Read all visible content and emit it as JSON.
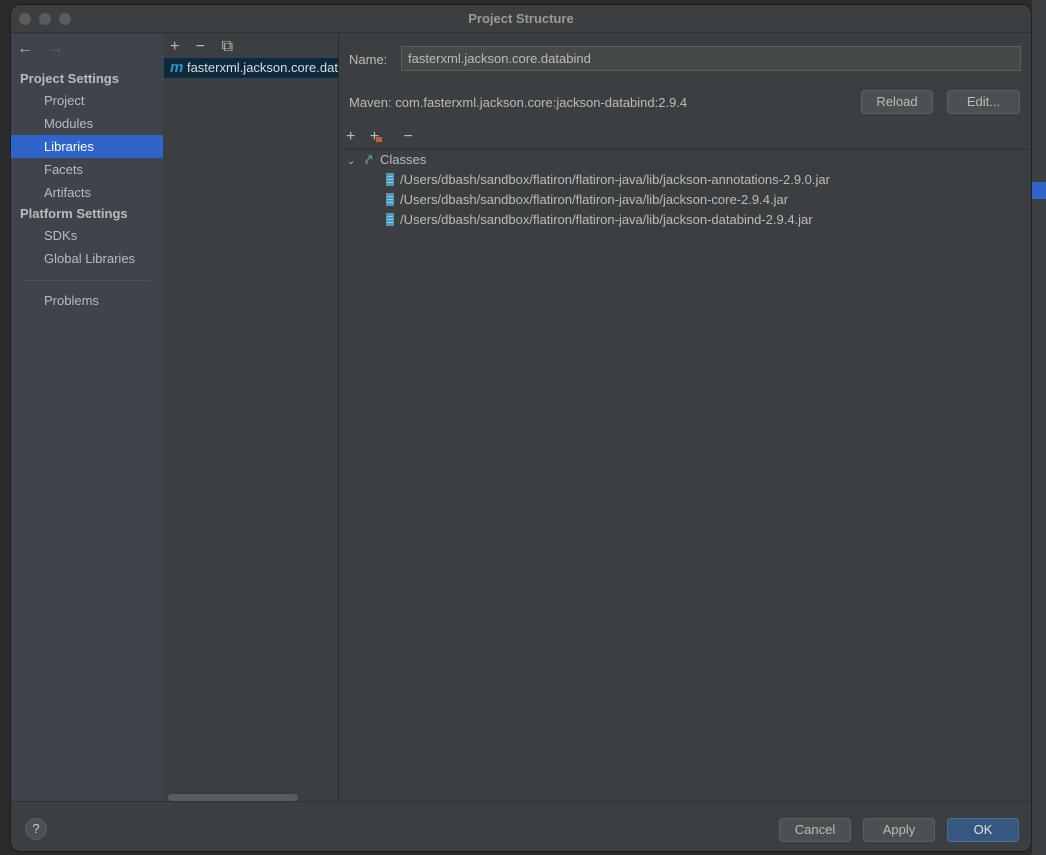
{
  "window": {
    "title": "Project Structure"
  },
  "sidebar": {
    "back_icon": "←",
    "forward_icon": "→",
    "sections": [
      {
        "title": "Project Settings",
        "items": [
          "Project",
          "Modules",
          "Libraries",
          "Facets",
          "Artifacts"
        ]
      },
      {
        "title": "Platform Settings",
        "items": [
          "SDKs",
          "Global Libraries"
        ]
      }
    ],
    "problems": "Problems",
    "selected": "Libraries"
  },
  "libraries": {
    "toolbar": [
      "+",
      "−",
      "⧉"
    ],
    "items": [
      {
        "icon": "m",
        "label": "fasterxml.jackson.core.databind"
      }
    ]
  },
  "detail": {
    "name_label": "Name:",
    "name_value": "fasterxml.jackson.core.databind",
    "maven": "Maven: com.fasterxml.jackson.core:jackson-databind:2.9.4",
    "reload": "Reload",
    "edit": "Edit...",
    "toolbar": [
      "+",
      "+",
      "−"
    ],
    "tree": {
      "root": "Classes",
      "children": [
        "/Users/dbash/sandbox/flatiron/flatiron-java/lib/jackson-annotations-2.9.0.jar",
        "/Users/dbash/sandbox/flatiron/flatiron-java/lib/jackson-core-2.9.4.jar",
        "/Users/dbash/sandbox/flatiron/flatiron-java/lib/jackson-databind-2.9.4.jar"
      ]
    }
  },
  "footer": {
    "help": "?",
    "cancel": "Cancel",
    "apply": "Apply",
    "ok": "OK"
  },
  "colors": {
    "selection": "#2f65ca",
    "ok": "#365880",
    "classes_icon": "#59a869",
    "add_folder_badge": "#c75e2c"
  }
}
